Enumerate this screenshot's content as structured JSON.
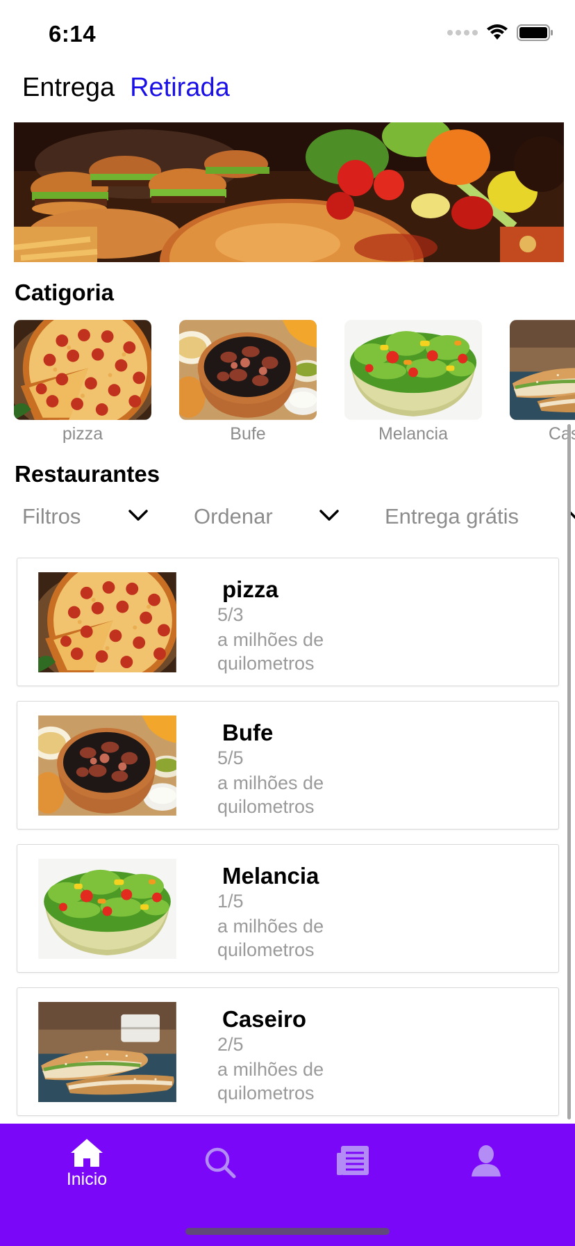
{
  "status_bar": {
    "time": "6:14"
  },
  "mode_tabs": [
    {
      "label": "Entrega",
      "active": false
    },
    {
      "label": "Retirada",
      "active": true
    }
  ],
  "colors": {
    "accent": "#1a10e6",
    "tab_bar": "#7a07f7",
    "muted_text": "#9a9a9a"
  },
  "hero": {
    "image": "food-banner-burgers-vegetables"
  },
  "categories": {
    "title": "Catigoria",
    "items": [
      {
        "label": "pizza",
        "image": "pizza"
      },
      {
        "label": "Bufe",
        "image": "feijoada-bowl"
      },
      {
        "label": "Melancia",
        "image": "salad-bowl"
      },
      {
        "label": "Caseiro",
        "image": "sandwich"
      }
    ]
  },
  "restaurants": {
    "title": "Restaurantes",
    "filters": [
      {
        "label": "Filtros",
        "icon": "chevron-down-icon"
      },
      {
        "label": "Ordenar",
        "icon": "chevron-down-icon"
      },
      {
        "label": "Entrega grátis",
        "icon": "chevron-down-icon"
      }
    ],
    "items": [
      {
        "name": "pizza",
        "rating": "5/3",
        "distance": "a milhões de quilometros",
        "image": "pizza"
      },
      {
        "name": "Bufe",
        "rating": "5/5",
        "distance": "a milhões de quilometros",
        "image": "feijoada-bowl"
      },
      {
        "name": "Melancia",
        "rating": "1/5",
        "distance": "a milhões de quilometros",
        "image": "salad-bowl"
      },
      {
        "name": "Caseiro",
        "rating": "2/5",
        "distance": "a milhões de quilometros",
        "image": "sandwich"
      }
    ]
  },
  "tab_bar": {
    "items": [
      {
        "label": "Inicio",
        "icon": "home-icon",
        "active": true
      },
      {
        "label": "",
        "icon": "search-icon",
        "active": false
      },
      {
        "label": "",
        "icon": "orders-list-icon",
        "active": false
      },
      {
        "label": "",
        "icon": "profile-icon",
        "active": false
      }
    ]
  }
}
